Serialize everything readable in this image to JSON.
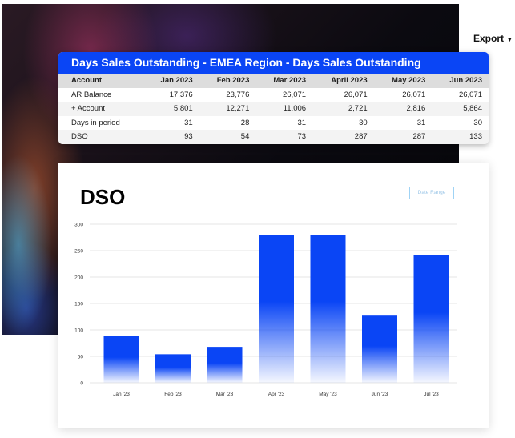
{
  "export_label": "Export",
  "export_icon": "caret-down-icon",
  "table": {
    "title": "Days Sales Outstanding - EMEA Region - Days Sales Outstanding",
    "headers": [
      "Account",
      "Jan 2023",
      "Feb 2023",
      "Mar 2023",
      "April 2023",
      "May 2023",
      "Jun 2023"
    ],
    "rows": [
      [
        "AR Balance",
        "17,376",
        "23,776",
        "26,071",
        "26,071",
        "26,071",
        "26,071"
      ],
      [
        "+ Account",
        "5,801",
        "12,271",
        "11,006",
        "2,721",
        "2,816",
        "5,864"
      ],
      [
        "Days in period",
        "31",
        "28",
        "31",
        "30",
        "31",
        "30"
      ],
      [
        "DSO",
        "93",
        "54",
        "73",
        "287",
        "287",
        "133"
      ]
    ]
  },
  "chart_data": {
    "type": "bar",
    "title": "DSO",
    "button": "Date Range",
    "categories": [
      "Jan '23",
      "Feb '23",
      "Mar '23",
      "Apr '23",
      "May '23",
      "Jun '23",
      "Jul '23"
    ],
    "values": [
      88,
      54,
      68,
      280,
      280,
      127,
      242
    ],
    "yticks": [
      0,
      50,
      100,
      150,
      200,
      250,
      300
    ],
    "ylim": [
      0,
      300
    ],
    "grid": true,
    "color": "#0a45f5"
  }
}
